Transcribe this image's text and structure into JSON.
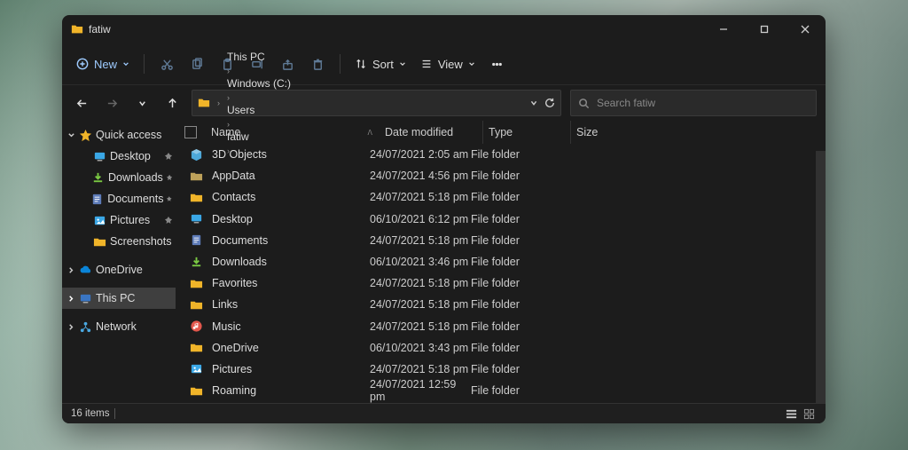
{
  "window": {
    "title": "fatiw"
  },
  "toolbar": {
    "new_label": "New",
    "sort_label": "Sort",
    "view_label": "View"
  },
  "breadcrumbs": [
    "This PC",
    "Windows (C:)",
    "Users",
    "fatiw"
  ],
  "search": {
    "placeholder": "Search fatiw"
  },
  "columns": {
    "name": "Name",
    "date": "Date modified",
    "type": "Type",
    "size": "Size"
  },
  "sidebar": {
    "quick_access": "Quick access",
    "quick_items": [
      {
        "label": "Desktop",
        "color": "#3aa7e6",
        "pinned": true
      },
      {
        "label": "Downloads",
        "color": "#7ac943",
        "pinned": true
      },
      {
        "label": "Documents",
        "color": "#5d7bb8",
        "pinned": true
      },
      {
        "label": "Pictures",
        "color": "#3aa7e6",
        "pinned": true
      },
      {
        "label": "Screenshots",
        "color": "#f0b429",
        "pinned": false
      }
    ],
    "onedrive": "OneDrive",
    "this_pc": "This PC",
    "network": "Network"
  },
  "items": [
    {
      "name": "3D Objects",
      "date": "24/07/2021 2:05 am",
      "type": "File folder",
      "icon": "cube",
      "color": "#4da8da"
    },
    {
      "name": "AppData",
      "date": "24/07/2021 4:56 pm",
      "type": "File folder",
      "icon": "folder",
      "color": "#bda15a"
    },
    {
      "name": "Contacts",
      "date": "24/07/2021 5:18 pm",
      "type": "File folder",
      "icon": "folder",
      "color": "#f0b429"
    },
    {
      "name": "Desktop",
      "date": "06/10/2021 6:12 pm",
      "type": "File folder",
      "icon": "desktop",
      "color": "#3aa7e6"
    },
    {
      "name": "Documents",
      "date": "24/07/2021 5:18 pm",
      "type": "File folder",
      "icon": "doc",
      "color": "#5d7bb8"
    },
    {
      "name": "Downloads",
      "date": "06/10/2021 3:46 pm",
      "type": "File folder",
      "icon": "download",
      "color": "#7ac943"
    },
    {
      "name": "Favorites",
      "date": "24/07/2021 5:18 pm",
      "type": "File folder",
      "icon": "folder",
      "color": "#f0b429"
    },
    {
      "name": "Links",
      "date": "24/07/2021 5:18 pm",
      "type": "File folder",
      "icon": "folder",
      "color": "#f0b429"
    },
    {
      "name": "Music",
      "date": "24/07/2021 5:18 pm",
      "type": "File folder",
      "icon": "music",
      "color": "#e2574c"
    },
    {
      "name": "OneDrive",
      "date": "06/10/2021 3:43 pm",
      "type": "File folder",
      "icon": "folder",
      "color": "#f0b429"
    },
    {
      "name": "Pictures",
      "date": "24/07/2021 5:18 pm",
      "type": "File folder",
      "icon": "pictures",
      "color": "#3aa7e6"
    },
    {
      "name": "Roaming",
      "date": "24/07/2021 12:59 pm",
      "type": "File folder",
      "icon": "folder",
      "color": "#f0b429"
    }
  ],
  "status": {
    "count": "16 items"
  }
}
